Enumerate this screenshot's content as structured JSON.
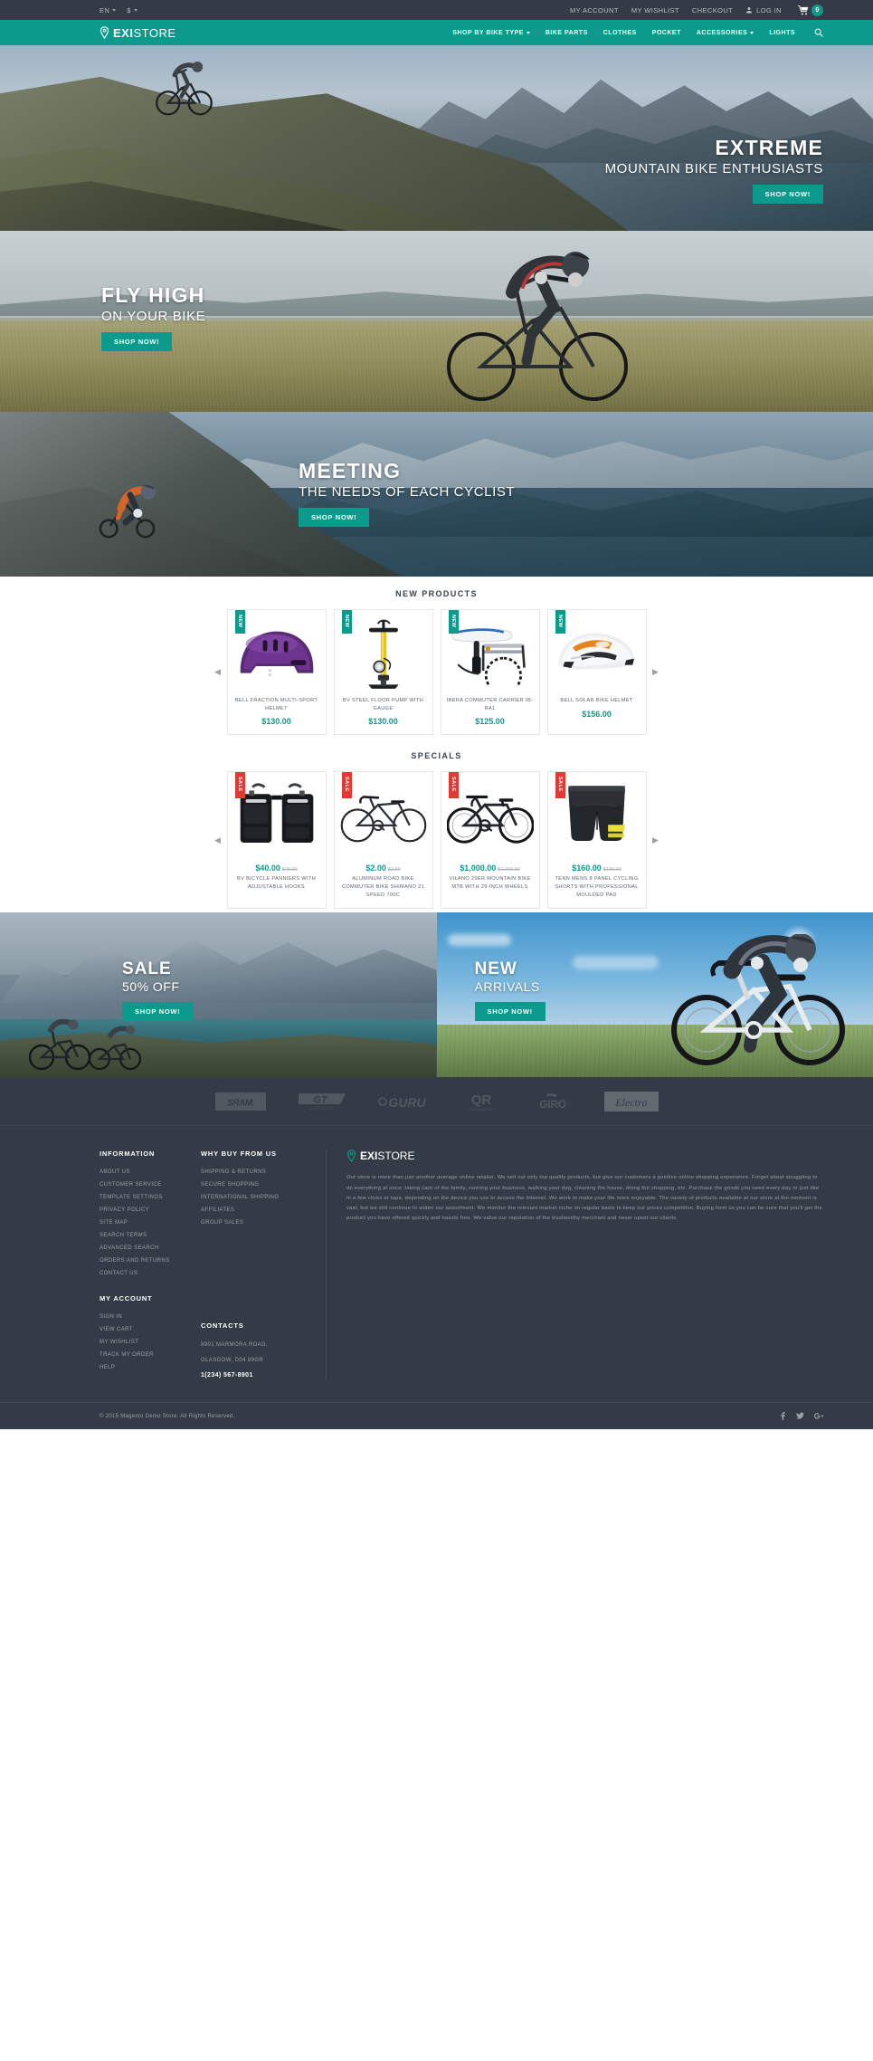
{
  "topbar": {
    "language": "EN",
    "currency": "$",
    "links": [
      {
        "label": "MY ACCOUNT",
        "name": "my-account"
      },
      {
        "label": "MY WISHLIST",
        "name": "my-wishlist"
      },
      {
        "label": "CHECKOUT",
        "name": "checkout"
      }
    ],
    "login_label": "LOG IN",
    "cart_count": "0"
  },
  "header": {
    "logo_bold": "EXI",
    "logo_light": "STORE",
    "nav": [
      {
        "label": "SHOP BY BIKE TYPE",
        "has_caret": true
      },
      {
        "label": "BIKE PARTS",
        "has_caret": false
      },
      {
        "label": "CLOTHES",
        "has_caret": false
      },
      {
        "label": "POCKET",
        "has_caret": false
      },
      {
        "label": "ACCESSORIES",
        "has_caret": true
      },
      {
        "label": "LIGHTS",
        "has_caret": false
      }
    ]
  },
  "slides": [
    {
      "head": "EXTREME",
      "sub": "MOUNTAIN BIKE ENTHUSIASTS",
      "cta": "SHOP NOW!"
    },
    {
      "head": "FLY HIGH",
      "sub": "ON YOUR BIKE",
      "cta": "SHOP NOW!"
    },
    {
      "head": "MEETING",
      "sub": "THE NEEDS OF EACH CYCLIST",
      "cta": "SHOP NOW!"
    }
  ],
  "new_products": {
    "title": "NEW PRODUCTS",
    "prev": "◀",
    "next": "▶",
    "items": [
      {
        "badge": "NEW",
        "name": "BELL FRACTION MULTI-SPORT HELMET",
        "price": "$130.00",
        "icon": "helmet-purple-icon"
      },
      {
        "badge": "NEW",
        "name": "BV STEEL FLOOR PUMP WITH GAUGE",
        "price": "$130.00",
        "icon": "floor-pump-icon"
      },
      {
        "badge": "NEW",
        "name": "IBERA COMMUTER CARRIER IB-RA1",
        "price": "$125.00",
        "icon": "bike-carrier-icon"
      },
      {
        "badge": "NEW",
        "name": "BELL SOLAR BIKE HELMET",
        "price": "$156.00",
        "icon": "helmet-white-icon"
      }
    ]
  },
  "specials": {
    "title": "SPECIALS",
    "prev": "◀",
    "next": "▶",
    "items": [
      {
        "badge": "SALE",
        "name": "BV BICYCLE PANNIERS WITH ADJUSTABLE HOOKS",
        "price": "$40.00",
        "old_price": "$45.00",
        "icon": "panniers-icon"
      },
      {
        "badge": "SALE",
        "name": "ALUMINUM ROAD BIKE COMMUTER BIKE SHIMANO 21 SPEED 700C",
        "price": "$2.00",
        "old_price": "$2.80",
        "icon": "road-bike-icon"
      },
      {
        "badge": "SALE",
        "name": "VILANO 29ER MOUNTAIN BIKE MTB WITH 29-INCH WHEELS",
        "price": "$1,000.00",
        "old_price": "$1,200.00",
        "icon": "mountain-bike-icon"
      },
      {
        "badge": "SALE",
        "name": "TENN MENS 8 PANEL CYCLING SHORTS WITH PROFESSIONAL MOULDED PAD",
        "price": "$160.00",
        "old_price": "$180.00",
        "icon": "cycling-shorts-icon"
      }
    ]
  },
  "promos": [
    {
      "head": "SALE",
      "sub": "50% OFF",
      "cta": "SHOP NOW!"
    },
    {
      "head": "NEW",
      "sub": "ARRIVALS",
      "cta": "SHOP NOW!"
    }
  ],
  "brands": [
    {
      "name": "SRAM",
      "label": "SRAM."
    },
    {
      "name": "GT Bicycles",
      "label": "GT"
    },
    {
      "name": "GURU",
      "label": "GURU"
    },
    {
      "name": "Quintana Roo",
      "label": "QR"
    },
    {
      "name": "GIRO",
      "label": "GIRO"
    },
    {
      "name": "Electra",
      "label": "Electra"
    }
  ],
  "footer": {
    "information": {
      "title": "INFORMATION",
      "links": [
        "ABOUT US",
        "CUSTOMER SERVICE",
        "TEMPLATE SETTINGS",
        "PRIVACY POLICY",
        "SITE MAP",
        "SEARCH TERMS",
        "ADVANCED SEARCH",
        "ORDERS AND RETURNS",
        "CONTACT US"
      ]
    },
    "why_buy": {
      "title": "WHY BUY FROM US",
      "links": [
        "SHIPPING & RETURNS",
        "SECURE SHOPPING",
        "INTERNATIONAL SHIPPING",
        "AFFILIATES",
        "GROUP SALES"
      ]
    },
    "my_account": {
      "title": "MY ACCOUNT",
      "links": [
        "SIGN IN",
        "VIEW CART",
        "MY WISHLIST",
        "TRACK MY ORDER",
        "HELP"
      ]
    },
    "contacts": {
      "title": "CONTACTS",
      "address_line1": "8901 MARMORA ROAD,",
      "address_line2": "GLASGOW, D04 89GR",
      "phone": "1(234) 567-8901"
    },
    "about": {
      "logo_bold": "EXI",
      "logo_light": "STORE",
      "paragraph": "Our store is more than just another average online retailer. We sell not only top quality products, but give our customers a positive online shopping experience. Forget about struggling to do everything at once: taking care of the family, running your business, walking your dog, cleaning the house, doing the shopping, etc. Purchase the goods you need every day or just like in a few clicks or taps, depending on the device you use to access the Internet. We work to make your life more enjoyable. The variety of products available at our store at the moment is vast, but we still continue to widen our assortment. We monitor the relevant market niche on regular basis to keep our prices competitive. Buying form us you can be sure that you'll get the product you have offered quickly and hassle free. We value our reputation of the trustworthy merchant and never upset our clients."
    },
    "copyright": "© 2015 Magento Demo Store. All Rights Reserved.",
    "socials": [
      {
        "name": "facebook-icon",
        "glyph": "f"
      },
      {
        "name": "twitter-icon",
        "glyph": "t"
      },
      {
        "name": "google-plus-icon",
        "glyph": "g+"
      }
    ]
  }
}
